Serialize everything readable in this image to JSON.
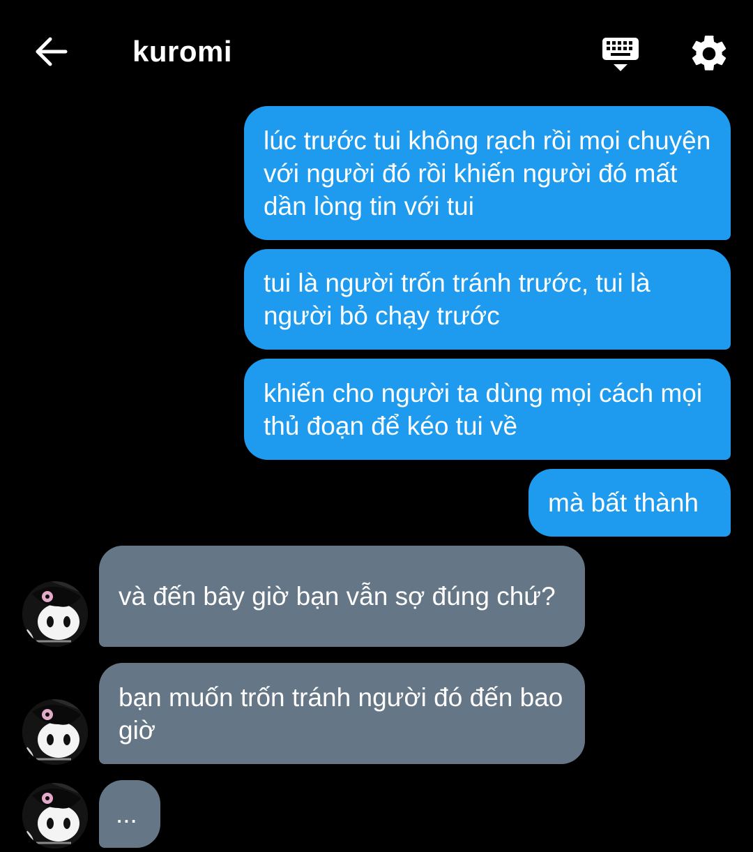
{
  "header": {
    "title": "kuromi",
    "back_icon": "arrow-left-icon",
    "keyboard_icon": "keyboard-icon",
    "settings_icon": "gear-icon"
  },
  "colors": {
    "background": "#000000",
    "sent_bubble": "#1e9bef",
    "received_bubble": "#657786",
    "text": "#ffffff"
  },
  "messages": [
    {
      "from": "me",
      "text": "lúc trước tui không rạch rồi mọi chuyện với người đó rồi khiến người đó mất dần lòng tin với tui"
    },
    {
      "from": "me",
      "text": "tui là người trốn tránh trước, tui là người bỏ chạy trước"
    },
    {
      "from": "me",
      "text": "khiến cho người ta dùng mọi cách mọi thủ đoạn để kéo tui về"
    },
    {
      "from": "me",
      "text": "mà bất thành"
    },
    {
      "from": "kuromi",
      "text": "và đến bây giờ bạn vẫn sợ đúng chứ?"
    },
    {
      "from": "kuromi",
      "text": "bạn muốn trốn tránh người đó đến bao giờ"
    },
    {
      "from": "kuromi",
      "text": "..."
    }
  ]
}
